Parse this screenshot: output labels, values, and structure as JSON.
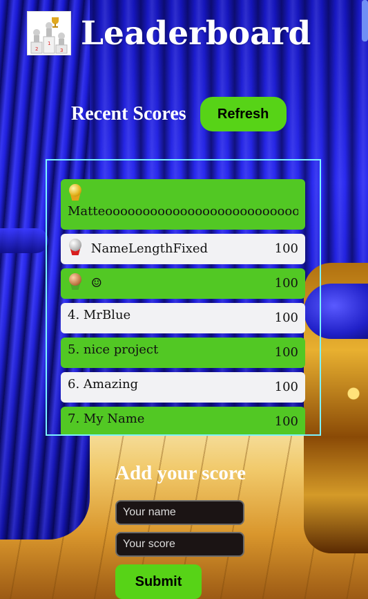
{
  "header": {
    "title": "Leaderboard",
    "logo_icon": "podium-trophy-icon"
  },
  "recent": {
    "label": "Recent Scores",
    "refresh_label": "Refresh"
  },
  "leaderboard": [
    {
      "rank": "1.",
      "medal": "gold-medal-icon",
      "name": "Matteooooooooooooooooooooooooooooooooo",
      "score": ""
    },
    {
      "rank": "2.",
      "medal": "silver-medal-icon",
      "name": "NameLengthFixed",
      "score": "100"
    },
    {
      "rank": "3.",
      "medal": "bronze-medal-icon",
      "name": "☺",
      "score": "100"
    },
    {
      "rank": "4.",
      "name": "MrBlue",
      "score": "100"
    },
    {
      "rank": "5.",
      "name": "nice project",
      "score": "100"
    },
    {
      "rank": "6.",
      "name": "Amazing",
      "score": "100"
    },
    {
      "rank": "7.",
      "name": "My Name",
      "score": "100"
    }
  ],
  "form": {
    "title": "Add your score",
    "name_placeholder": "Your name",
    "score_placeholder": "Your score",
    "submit_label": "Submit"
  },
  "colors": {
    "accent_green": "#57d317",
    "row_green": "#52c824",
    "row_light": "#f2f2f4",
    "board_border": "#7cf3ff"
  }
}
